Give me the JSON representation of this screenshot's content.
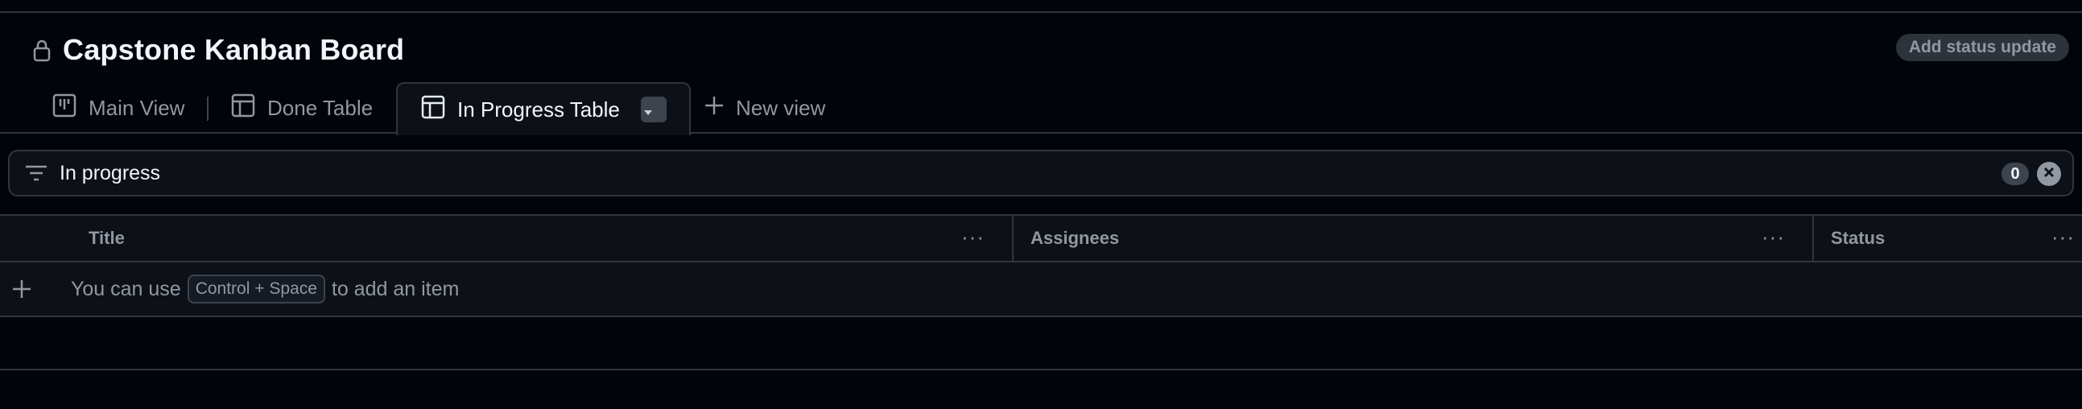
{
  "project": {
    "title": "Capstone Kanban Board",
    "status_button": "Add status update"
  },
  "tabs": [
    {
      "label": "Main View",
      "icon": "board-icon"
    },
    {
      "label": "Done Table",
      "icon": "table-icon"
    },
    {
      "label": "In Progress Table",
      "icon": "table-icon",
      "active": true
    },
    {
      "label": "New view",
      "icon": "plus-icon"
    }
  ],
  "filter": {
    "text": "In progress",
    "count": "0"
  },
  "table": {
    "columns": [
      {
        "label": "Title"
      },
      {
        "label": "Assignees"
      },
      {
        "label": "Status"
      }
    ],
    "add_hint": {
      "prefix": "You can use",
      "shortcut": "Control + Space",
      "suffix": "to add an item"
    },
    "column_menu": "···"
  }
}
